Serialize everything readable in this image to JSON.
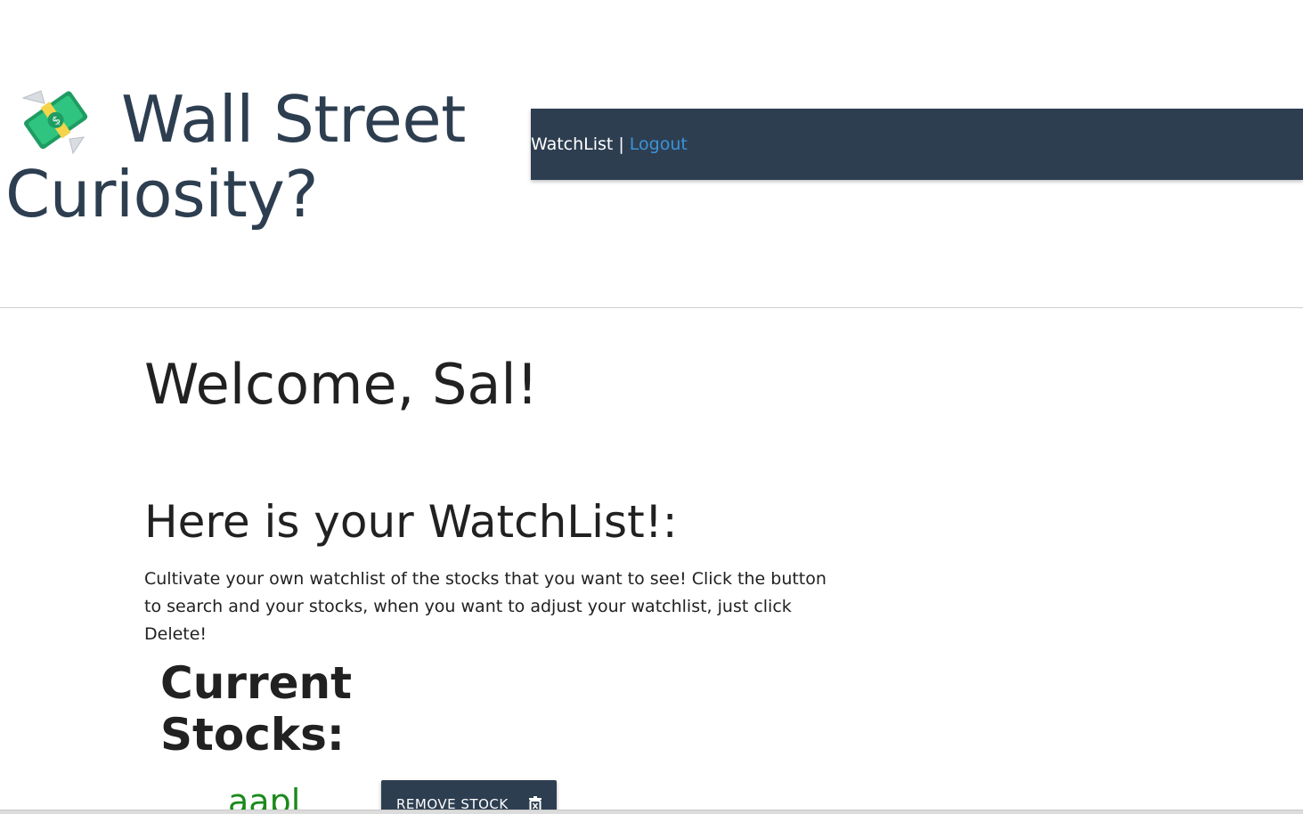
{
  "header": {
    "brand_title": "Wall Street Curiosity?",
    "brand_icon": "money-with-wings-icon",
    "nav": {
      "watchlist_label": "WatchList",
      "separator": "|",
      "logout_label": "Logout"
    }
  },
  "main": {
    "welcome": "Welcome, Sal!",
    "watchlist_heading": "Here is your WatchList!:",
    "intro": "Cultivate your own watchlist of the stocks that you want to see! Click the button to search and your stocks, when you want to adjust your watchlist, just click Delete!",
    "current_heading": "Current Stocks:",
    "stocks": [
      {
        "symbol": "aapl",
        "remove_label": "Remove Stock",
        "remove_icon": "trash-icon"
      }
    ]
  },
  "colors": {
    "navbar_bg": "#2e3e51",
    "brand_text": "#2d3e50",
    "logout_link": "#3a94d8",
    "stock_symbol": "#1b8a1b"
  }
}
